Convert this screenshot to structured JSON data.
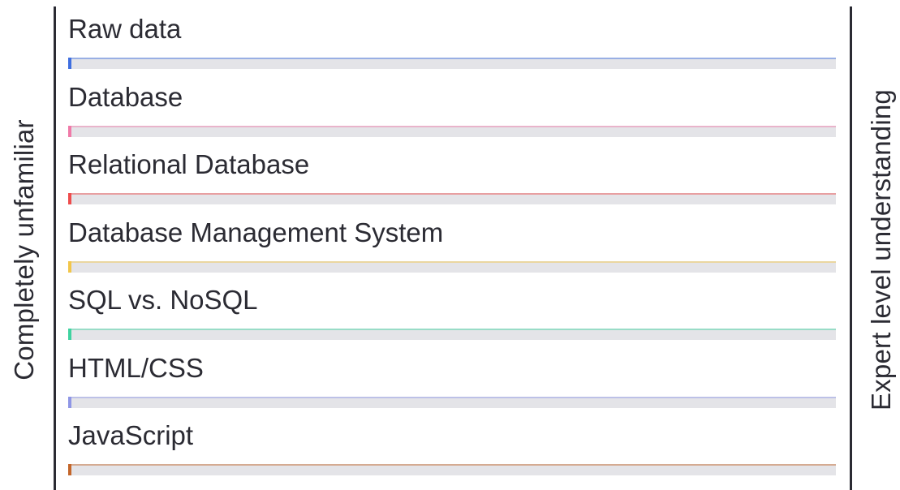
{
  "axis": {
    "left_label": "Completely unfamiliar",
    "right_label": "Expert level understanding"
  },
  "chart_data": {
    "type": "bar",
    "orientation": "horizontal",
    "xlim": [
      0,
      1
    ],
    "categories": [
      "Raw data",
      "Database",
      "Relational Database",
      "Database Management System",
      "SQL vs. NoSQL",
      "HTML/CSS",
      "JavaScript"
    ],
    "values": [
      0,
      0,
      0,
      0,
      0,
      0,
      0
    ],
    "colors": [
      "#3f6fe0",
      "#f07aa8",
      "#ee4c4c",
      "#f2c64a",
      "#3fd3a0",
      "#8f96e6",
      "#c4662a"
    ],
    "grid": false
  }
}
